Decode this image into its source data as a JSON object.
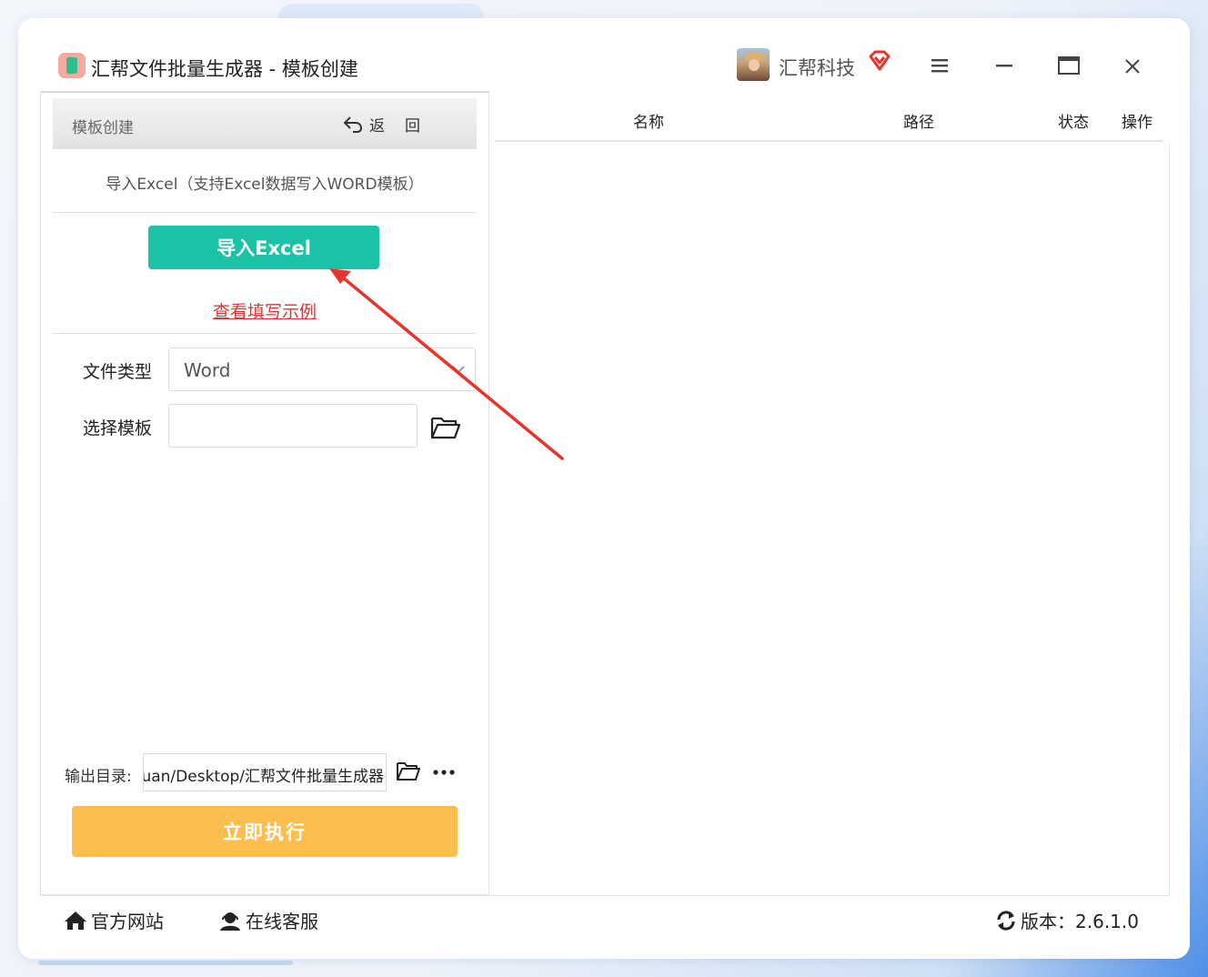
{
  "window": {
    "title": "汇帮文件批量生成器 - 模板创建",
    "brand_name": "汇帮科技"
  },
  "left_panel": {
    "header_title": "模板创建",
    "back_label": "返回",
    "import_description": "导入Excel（支持Excel数据写入WORD模板）",
    "import_button": "导入Excel",
    "example_link": "查看填写示例",
    "file_type_label": "文件类型",
    "file_type_value": "Word",
    "template_label": "选择模板",
    "template_value": "",
    "output_label": "输出目录:",
    "output_value": "uan/Desktop/汇帮文件批量生成器",
    "execute_button": "立即执行"
  },
  "table": {
    "columns": [
      "名称",
      "路径",
      "状态",
      "操作"
    ],
    "rows": []
  },
  "footer": {
    "website_link": "官方网站",
    "support_link": "在线客服",
    "version": "版本：2.6.1.0"
  },
  "colors": {
    "import_button": "#1cc2a6",
    "execute_button": "#febd4f",
    "example_link": "#d93636",
    "annotation_arrow": "#e8322b"
  },
  "icons": [
    "app-icon",
    "avatar",
    "vip-diamond-icon",
    "menu-icon",
    "minimize-icon",
    "maximize-icon",
    "close-icon",
    "back-arrow-icon",
    "chevron-down-icon",
    "folder-icon",
    "more-icon",
    "home-icon",
    "user-support-icon",
    "refresh-icon"
  ]
}
